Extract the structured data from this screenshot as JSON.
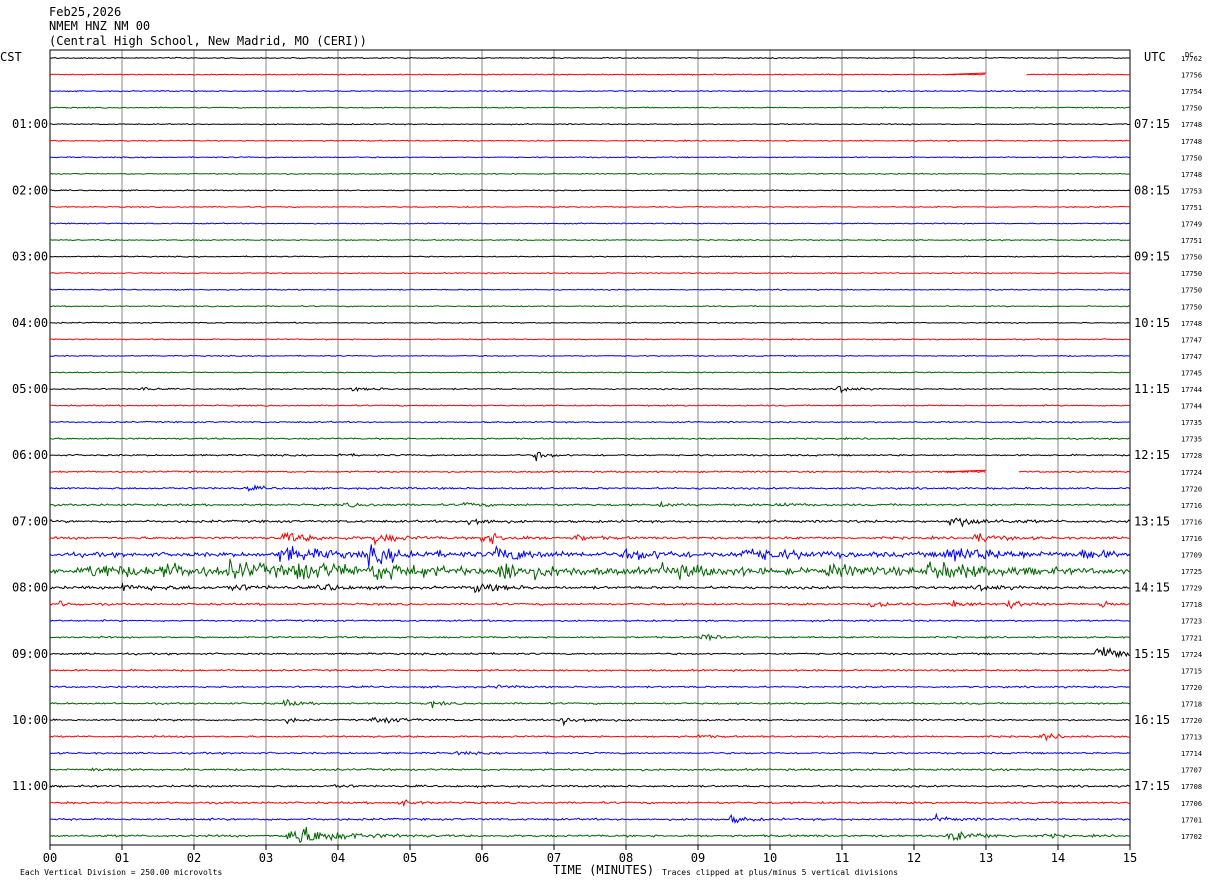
{
  "header": {
    "date": "Feb25,2026",
    "station": "NMEM HNZ NM 00",
    "location": "(Central High School, New Madrid, MO (CERI))"
  },
  "left_timezone": "CST",
  "right_timezone": "UTC",
  "dc_label": "DC",
  "footer": {
    "scale_note": "Each Vertical Division =  250.00 microvolts",
    "xlabel": "TIME (MINUTES)",
    "clip_note": "Traces clipped at plus/minus 5 vertical divisions"
  },
  "chart_data": {
    "type": "helicorder",
    "trace_minutes": 15,
    "traces_per_hour": 4,
    "x_ticks": [
      "00",
      "01",
      "02",
      "03",
      "04",
      "05",
      "06",
      "07",
      "08",
      "09",
      "10",
      "11",
      "12",
      "13",
      "14",
      "15"
    ],
    "left_hour_labels": [
      {
        "label": "01:00",
        "trace": 4
      },
      {
        "label": "02:00",
        "trace": 8
      },
      {
        "label": "03:00",
        "trace": 12
      },
      {
        "label": "04:00",
        "trace": 16
      },
      {
        "label": "05:00",
        "trace": 20
      },
      {
        "label": "06:00",
        "trace": 24
      },
      {
        "label": "07:00",
        "trace": 28
      },
      {
        "label": "08:00",
        "trace": 32
      },
      {
        "label": "09:00",
        "trace": 36
      },
      {
        "label": "10:00",
        "trace": 40
      },
      {
        "label": "11:00",
        "trace": 44
      }
    ],
    "right_hour_labels": [
      {
        "label": "07:15",
        "trace": 4
      },
      {
        "label": "08:15",
        "trace": 8
      },
      {
        "label": "09:15",
        "trace": 12
      },
      {
        "label": "10:15",
        "trace": 16
      },
      {
        "label": "11:15",
        "trace": 20
      },
      {
        "label": "12:15",
        "trace": 24
      },
      {
        "label": "13:15",
        "trace": 28
      },
      {
        "label": "14:15",
        "trace": 32
      },
      {
        "label": "15:15",
        "trace": 36
      },
      {
        "label": "16:15",
        "trace": 40
      },
      {
        "label": "17:15",
        "trace": 44
      }
    ],
    "trace_colors": [
      "#000000",
      "#ff0000",
      "#0000ff",
      "#006400"
    ],
    "dc_offsets": [
      "17762",
      "17756",
      "17754",
      "17750",
      "17748",
      "17748",
      "17750",
      "17748",
      "17753",
      "17751",
      "17749",
      "17751",
      "17750",
      "17750",
      "17750",
      "17750",
      "17748",
      "17747",
      "17747",
      "17745",
      "17744",
      "17744",
      "17735",
      "17735",
      "17728",
      "17724",
      "17720",
      "17716",
      "17716",
      "17716",
      "17709",
      "17725",
      "17729",
      "17718",
      "17723",
      "17721",
      "17724",
      "17715",
      "17720",
      "17718",
      "17720",
      "17713",
      "17714",
      "17707",
      "17708",
      "17706",
      "17701",
      "17702"
    ],
    "noise_level": [
      1,
      1,
      1,
      1,
      1,
      1,
      1,
      1,
      1,
      1,
      1,
      1,
      1,
      1,
      1,
      1,
      1,
      1,
      1,
      1,
      1.2,
      1.2,
      1.3,
      1.4,
      1.5,
      1.5,
      1.8,
      1.8,
      2.2,
      2.2,
      4,
      4.5,
      2.5,
      1.8,
      1.5,
      1.5,
      1.6,
      1.6,
      1.6,
      1.6,
      1.6,
      1.6,
      1.6,
      1.8,
      1.8,
      1.8,
      1.9,
      1.9
    ],
    "gaps": [
      {
        "trace": 1,
        "start_min": 13.0,
        "end_min": 13.55
      },
      {
        "trace": 25,
        "start_min": 13.0,
        "end_min": 13.45
      }
    ],
    "events": [
      {
        "trace": 20,
        "minute": 1.25,
        "amp": 6,
        "dur": 0.15
      },
      {
        "trace": 20,
        "minute": 4.2,
        "amp": 2.5,
        "dur": 0.6
      },
      {
        "trace": 20,
        "minute": 10.95,
        "amp": 9,
        "dur": 0.25
      },
      {
        "trace": 24,
        "minute": 6.75,
        "amp": 8,
        "dur": 0.25
      },
      {
        "trace": 24,
        "minute": 4.0,
        "amp": 2.5,
        "dur": 0.3
      },
      {
        "trace": 26,
        "minute": 2.75,
        "amp": 4,
        "dur": 0.3
      },
      {
        "trace": 27,
        "minute": 4.1,
        "amp": 3,
        "dur": 0.5
      },
      {
        "trace": 27,
        "minute": 5.75,
        "amp": 4,
        "dur": 0.4
      },
      {
        "trace": 27,
        "minute": 8.45,
        "amp": 3,
        "dur": 0.4
      },
      {
        "trace": 27,
        "minute": 10.1,
        "amp": 4,
        "dur": 0.35
      },
      {
        "trace": 28,
        "minute": 5.8,
        "amp": 10,
        "dur": 0.35
      },
      {
        "trace": 28,
        "minute": 12.5,
        "amp": 8,
        "dur": 0.8
      },
      {
        "trace": 29,
        "minute": 3.2,
        "amp": 10,
        "dur": 0.6
      },
      {
        "trace": 29,
        "minute": 4.5,
        "amp": 9,
        "dur": 0.5
      },
      {
        "trace": 29,
        "minute": 6.0,
        "amp": 12,
        "dur": 0.5
      },
      {
        "trace": 29,
        "minute": 7.3,
        "amp": 6,
        "dur": 0.35
      },
      {
        "trace": 29,
        "minute": 12.85,
        "amp": 8,
        "dur": 0.5
      },
      {
        "trace": 30,
        "minute": 3.2,
        "amp": 13,
        "dur": 1.0
      },
      {
        "trace": 30,
        "minute": 4.4,
        "amp": 12,
        "dur": 1.0
      },
      {
        "trace": 30,
        "minute": 6.2,
        "amp": 12,
        "dur": 0.8
      },
      {
        "trace": 30,
        "minute": 8.0,
        "amp": 9,
        "dur": 1.0
      },
      {
        "trace": 30,
        "minute": 9.6,
        "amp": 10,
        "dur": 1.2
      },
      {
        "trace": 30,
        "minute": 12.4,
        "amp": 14,
        "dur": 1.2
      },
      {
        "trace": 30,
        "minute": 14.3,
        "amp": 8,
        "dur": 0.5
      },
      {
        "trace": 31,
        "minute": 0.5,
        "amp": 12,
        "dur": 1.2
      },
      {
        "trace": 31,
        "minute": 1.5,
        "amp": 10,
        "dur": 1.0
      },
      {
        "trace": 31,
        "minute": 2.5,
        "amp": 12,
        "dur": 1.2
      },
      {
        "trace": 31,
        "minute": 3.4,
        "amp": 14,
        "dur": 1.2
      },
      {
        "trace": 31,
        "minute": 4.5,
        "amp": 12,
        "dur": 1.2
      },
      {
        "trace": 31,
        "minute": 6.2,
        "amp": 14,
        "dur": 1.4
      },
      {
        "trace": 31,
        "minute": 8.5,
        "amp": 10,
        "dur": 1.5
      },
      {
        "trace": 31,
        "minute": 10.8,
        "amp": 9,
        "dur": 1.2
      },
      {
        "trace": 31,
        "minute": 12.2,
        "amp": 14,
        "dur": 1.4
      },
      {
        "trace": 32,
        "minute": 1.0,
        "amp": 5,
        "dur": 1.0
      },
      {
        "trace": 32,
        "minute": 2.5,
        "amp": 7,
        "dur": 0.4
      },
      {
        "trace": 32,
        "minute": 3.75,
        "amp": 8,
        "dur": 0.4
      },
      {
        "trace": 32,
        "minute": 5.9,
        "amp": 8,
        "dur": 0.6
      },
      {
        "trace": 32,
        "minute": 12.9,
        "amp": 6,
        "dur": 0.4
      },
      {
        "trace": 33,
        "minute": 0.1,
        "amp": 6,
        "dur": 0.3
      },
      {
        "trace": 33,
        "minute": 11.4,
        "amp": 8,
        "dur": 0.3
      },
      {
        "trace": 33,
        "minute": 12.55,
        "amp": 7,
        "dur": 0.35
      },
      {
        "trace": 33,
        "minute": 13.3,
        "amp": 9,
        "dur": 0.35
      },
      {
        "trace": 33,
        "minute": 14.6,
        "amp": 7,
        "dur": 0.3
      },
      {
        "trace": 35,
        "minute": 9.05,
        "amp": 6,
        "dur": 0.4
      },
      {
        "trace": 36,
        "minute": 14.55,
        "amp": 20,
        "dur": 0.5
      },
      {
        "trace": 36,
        "minute": 5.8,
        "amp": 4,
        "dur": 0.15
      },
      {
        "trace": 38,
        "minute": 6.2,
        "amp": 3,
        "dur": 0.3
      },
      {
        "trace": 39,
        "minute": 3.25,
        "amp": 6,
        "dur": 0.3
      },
      {
        "trace": 39,
        "minute": 5.3,
        "amp": 6,
        "dur": 0.2
      },
      {
        "trace": 40,
        "minute": 3.3,
        "amp": 5,
        "dur": 0.2
      },
      {
        "trace": 40,
        "minute": 4.5,
        "amp": 6,
        "dur": 0.6
      },
      {
        "trace": 40,
        "minute": 7.1,
        "amp": 8,
        "dur": 0.5
      },
      {
        "trace": 41,
        "minute": 9.0,
        "amp": 4,
        "dur": 0.2
      },
      {
        "trace": 41,
        "minute": 13.8,
        "amp": 6,
        "dur": 0.3
      },
      {
        "trace": 42,
        "minute": 5.65,
        "amp": 3,
        "dur": 0.3
      },
      {
        "trace": 43,
        "minute": 0.6,
        "amp": 3,
        "dur": 0.3
      },
      {
        "trace": 44,
        "minute": 3.95,
        "amp": 3,
        "dur": 0.3
      },
      {
        "trace": 45,
        "minute": 4.85,
        "amp": 6,
        "dur": 0.3
      },
      {
        "trace": 46,
        "minute": 9.45,
        "amp": 7,
        "dur": 0.3
      },
      {
        "trace": 46,
        "minute": 12.3,
        "amp": 5,
        "dur": 0.4
      },
      {
        "trace": 47,
        "minute": 3.3,
        "amp": 22,
        "dur": 0.9
      },
      {
        "trace": 47,
        "minute": 12.5,
        "amp": 10,
        "dur": 0.6
      },
      {
        "trace": 47,
        "minute": 13.85,
        "amp": 4,
        "dur": 0.2
      }
    ]
  }
}
